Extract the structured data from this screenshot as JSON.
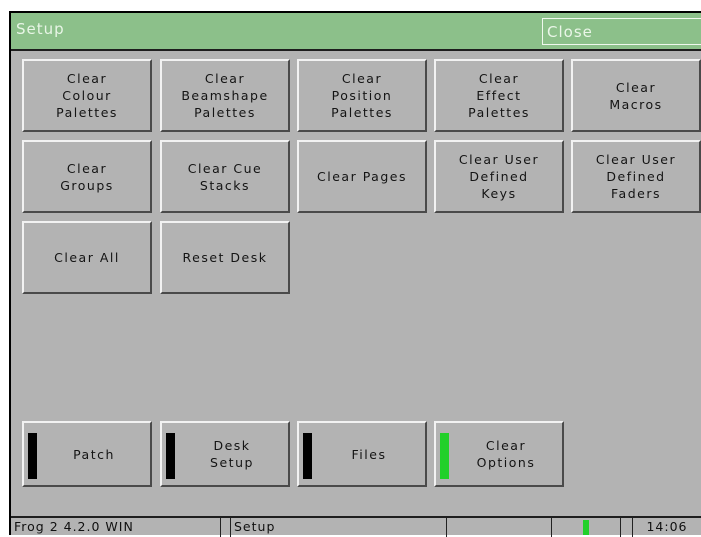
{
  "window": {
    "title": "Setup",
    "close_label": "Close"
  },
  "clear_buttons": [
    "Clear\nColour\nPalettes",
    "Clear\nBeamshape\nPalettes",
    "Clear\nPosition\nPalettes",
    "Clear\nEffect\nPalettes",
    "Clear\nMacros",
    "Clear\nGroups",
    "Clear Cue\nStacks",
    "Clear Pages",
    "Clear User\nDefined\nKeys",
    "Clear User\nDefined\nFaders",
    "Clear All",
    "Reset Desk"
  ],
  "nav_buttons": [
    {
      "label": "Patch",
      "active": false
    },
    {
      "label": "Desk\nSetup",
      "active": false
    },
    {
      "label": "Files",
      "active": false
    },
    {
      "label": "Clear\nOptions",
      "active": true
    }
  ],
  "status": {
    "version": "Frog 2 4.2.0 WIN",
    "page": "Setup",
    "time": "14:06"
  },
  "colors": {
    "titlebar": "#8cc08a",
    "panel": "#b3b3b3",
    "indicator_active": "#22d02a",
    "indicator_inactive": "#000000"
  }
}
